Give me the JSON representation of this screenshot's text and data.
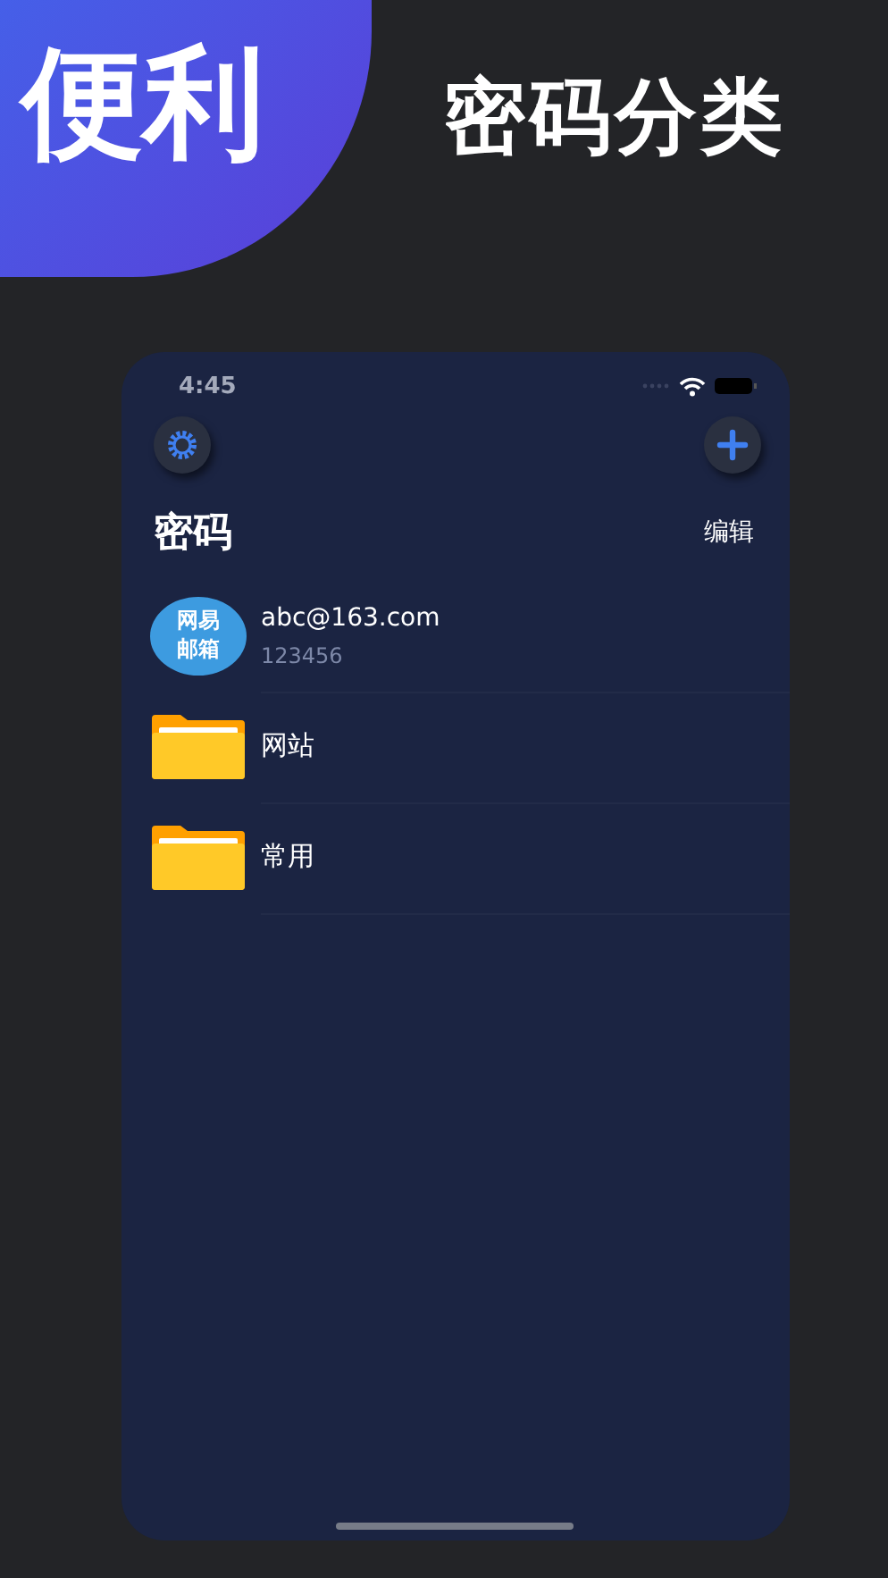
{
  "banner": {
    "badge": "便利",
    "headline": "密码分类"
  },
  "status_bar": {
    "time": "4:45"
  },
  "title": "密码",
  "edit_button": "编辑",
  "items": [
    {
      "kind": "account",
      "avatar": "网易邮箱",
      "title": "abc@163.com",
      "subtitle": "123456"
    },
    {
      "kind": "folder",
      "title": "网站"
    },
    {
      "kind": "folder",
      "title": "常用"
    }
  ]
}
